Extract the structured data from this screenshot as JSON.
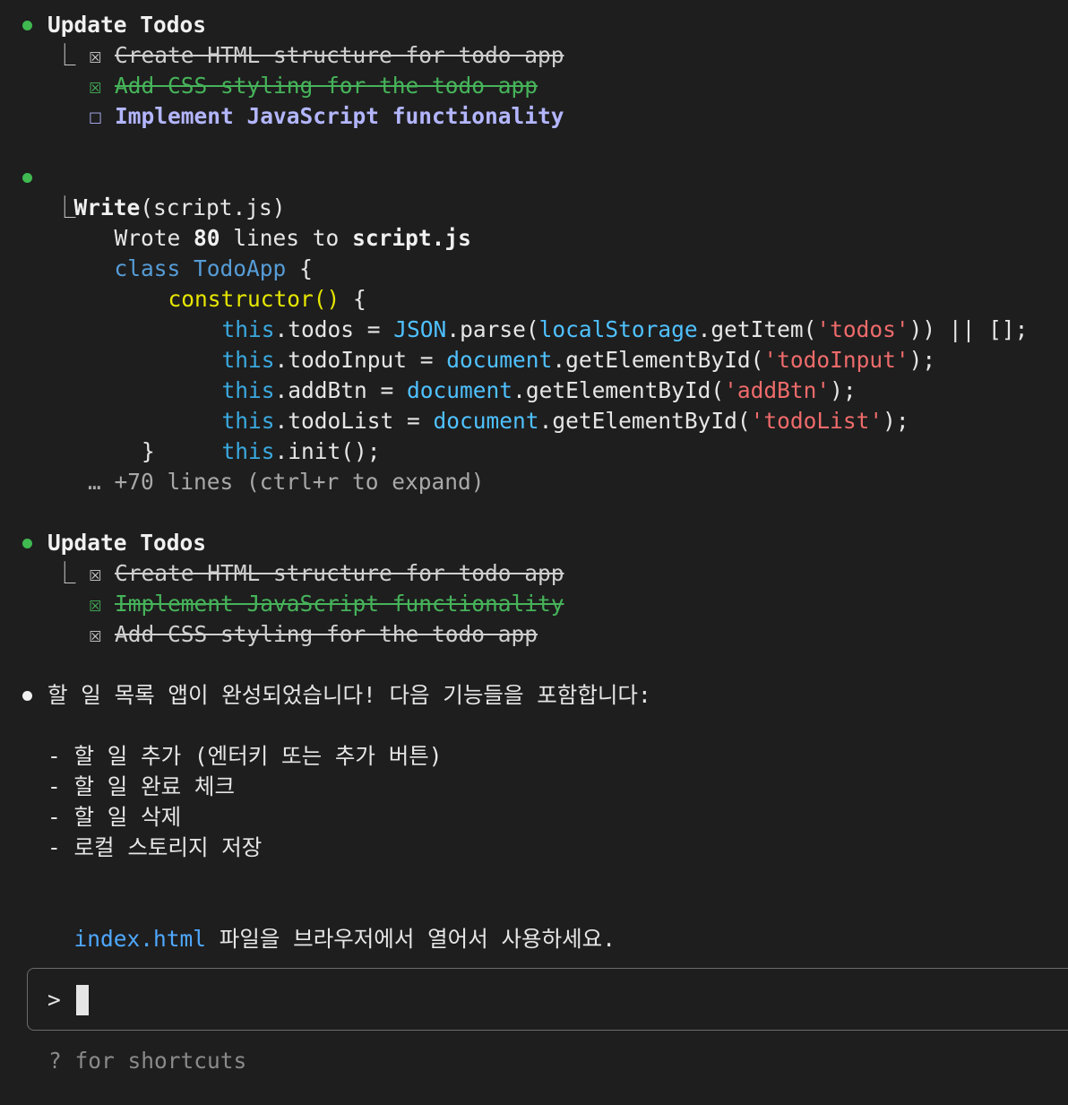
{
  "colors": {
    "background": "#1e1e1e",
    "bullet_tool": "#3fb950",
    "bullet_message": "#f0f0f0",
    "completed_green": "#46b35a",
    "pending_todo": "#b3b6ff",
    "keyword": "#569cd6",
    "string": "#ef6b6b",
    "function": "#e6e600"
  },
  "icons": {
    "tree_connector": "⎿",
    "checked_box": "☒",
    "unchecked_box": "☐",
    "prompt_chevron": ">"
  },
  "blocks": [
    {
      "type": "todos",
      "title": "Update Todos",
      "items": [
        {
          "label": "Create HTML structure for todo app",
          "status": "completed"
        },
        {
          "label": "Add CSS styling for the todo app",
          "status": "just_completed"
        },
        {
          "label": "Implement JavaScript functionality",
          "status": "pending"
        }
      ]
    },
    {
      "type": "write",
      "tool": "Write",
      "arg": "(script.js)",
      "summary_prefix": "Wrote ",
      "summary_count": "80",
      "summary_mid": " lines to ",
      "summary_file": "script.js",
      "code": {
        "l1_kw": "class",
        "l1_name": "TodoApp",
        "l1_rest": " {",
        "l2_fn": "constructor",
        "l2_paren": "()",
        "l2_rest": " {",
        "l3_this": "this",
        "l3_a": ".todos = ",
        "l3_json": "JSON",
        "l3_b": ".parse(",
        "l3_ls": "localStorage",
        "l3_c": ".getItem(",
        "l3_str": "'todos'",
        "l3_d": ")) || [];",
        "l4_this": "this",
        "l4_a": ".todoInput = ",
        "l4_doc": "document",
        "l4_b": ".getElementById(",
        "l4_str": "'todoInput'",
        "l4_c": ");",
        "l5_this": "this",
        "l5_a": ".addBtn = ",
        "l5_doc": "document",
        "l5_b": ".getElementById(",
        "l5_str": "'addBtn'",
        "l5_c": ");",
        "l6_this": "this",
        "l6_a": ".todoList = ",
        "l6_doc": "document",
        "l6_b": ".getElementById(",
        "l6_str": "'todoList'",
        "l6_c": ");",
        "l7_this": "this",
        "l7_a": ".init();",
        "l8": "}"
      },
      "more": "… +70 lines (ctrl+r to expand)"
    },
    {
      "type": "todos",
      "title": "Update Todos",
      "items": [
        {
          "label": "Create HTML structure for todo app",
          "status": "completed"
        },
        {
          "label": "Implement JavaScript functionality",
          "status": "just_completed"
        },
        {
          "label": "Add CSS styling for the todo app",
          "status": "completed"
        }
      ]
    },
    {
      "type": "message",
      "headline": "할 일 목록 앱이 완성되었습니다! 다음 기능들을 포함합니다:",
      "features": [
        "- 할 일 추가 (엔터키 또는 추가 버튼)",
        "- 할 일 완료 체크",
        "- 할 일 삭제",
        "- 로컬 스토리지 저장"
      ],
      "footer_link": "index.html",
      "footer_text": " 파일을 브라우저에서 열어서 사용하세요."
    }
  ],
  "input": {
    "value": "",
    "hint": "? for shortcuts"
  }
}
